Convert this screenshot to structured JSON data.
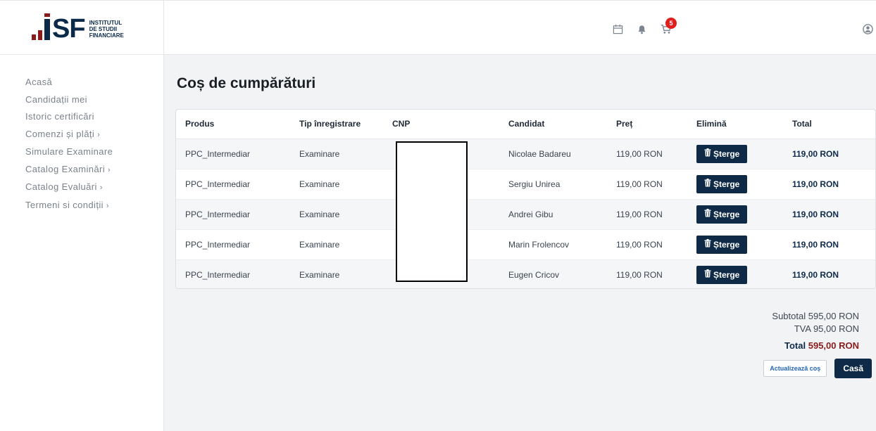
{
  "logo": {
    "letters": "SF",
    "subtitle": [
      "INSTITUTUL",
      "DE STUDII",
      "FINANCIARE"
    ]
  },
  "header": {
    "cart_count": "5",
    "icons": [
      "calendar-icon",
      "bell-icon",
      "cart-icon",
      "user-icon"
    ]
  },
  "sidebar": {
    "items": [
      {
        "label": "Acasă",
        "has_chevron": false
      },
      {
        "label": "Candidații mei",
        "has_chevron": false
      },
      {
        "label": "Istoric certificări",
        "has_chevron": false
      },
      {
        "label": "Comenzi și plăți",
        "has_chevron": true
      },
      {
        "label": "Simulare Examinare",
        "has_chevron": false
      },
      {
        "label": "Catalog Examinări",
        "has_chevron": true
      },
      {
        "label": "Catalog Evaluări",
        "has_chevron": true
      },
      {
        "label": "Termeni si condiții",
        "has_chevron": true
      }
    ],
    "chevron": "›"
  },
  "page": {
    "title": "Coș de cumpărături"
  },
  "table": {
    "headers": [
      "Produs",
      "Tip înregistrare",
      "CNP",
      "Candidat",
      "Preț",
      "Elimină",
      "Total"
    ],
    "delete_label": "Șterge",
    "rows": [
      {
        "produs": "PPC_Intermediar",
        "tip": "Examinare",
        "cnp": "",
        "candidat": "Nicolae Badareu",
        "pret": "119,00 RON",
        "total": "119,00 RON"
      },
      {
        "produs": "PPC_Intermediar",
        "tip": "Examinare",
        "cnp": "",
        "candidat": "Sergiu Unirea",
        "pret": "119,00 RON",
        "total": "119,00 RON"
      },
      {
        "produs": "PPC_Intermediar",
        "tip": "Examinare",
        "cnp": "",
        "candidat": "Andrei Gibu",
        "pret": "119,00 RON",
        "total": "119,00 RON"
      },
      {
        "produs": "PPC_Intermediar",
        "tip": "Examinare",
        "cnp": "",
        "candidat": "Marin Frolencov",
        "pret": "119,00 RON",
        "total": "119,00 RON"
      },
      {
        "produs": "PPC_Intermediar",
        "tip": "Examinare",
        "cnp": "",
        "candidat": "Eugen Cricov",
        "pret": "119,00 RON",
        "total": "119,00 RON"
      }
    ]
  },
  "summary": {
    "subtotal_label": "Subtotal",
    "subtotal_value": "595,00 RON",
    "tva_label": "TVA",
    "tva_value": "95,00 RON",
    "total_label": "Total",
    "total_value": "595,00 RON"
  },
  "actions": {
    "update_label": "Actualizează coș",
    "checkout_label": "Casă"
  },
  "colors": {
    "primary": "#0e2a47",
    "accent_red": "#8a1c1c",
    "badge": "#e11d1d",
    "link": "#2464b8"
  }
}
